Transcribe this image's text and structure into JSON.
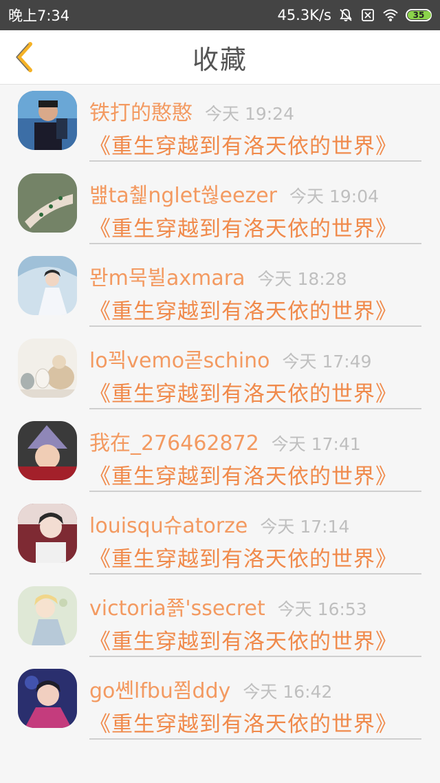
{
  "status_bar": {
    "time": "晚上7:34",
    "network_speed": "45.3K/s",
    "battery_level": "35",
    "icons": [
      "mute-bell-icon",
      "sim-card-icon",
      "wifi-icon",
      "battery-icon"
    ]
  },
  "header": {
    "title": "收藏",
    "back_icon": "chevron-left-icon",
    "accent_color": "#f39a61"
  },
  "favorites": [
    {
      "user": "铁打的憨憨",
      "time": "今天 19:24",
      "novel": "《重生穿越到有洛天依的世界》"
    },
    {
      "user": "뱶ta췙nglet쒆eezer",
      "time": "今天 19:04",
      "novel": "《重生穿越到有洛天依的世界》"
    },
    {
      "user": "뫈m묵뷜axmara",
      "time": "今天 18:28",
      "novel": "《重生穿越到有洛天依的世界》"
    },
    {
      "user": "lo꾁vemo콛schino",
      "time": "今天 17:49",
      "novel": "《重生穿越到有洛天依的世界》"
    },
    {
      "user": "我在_276462872",
      "time": "今天 17:41",
      "novel": "《重生穿越到有洛天依的世界》"
    },
    {
      "user": "louisqu슈atorze",
      "time": "今天 17:14",
      "novel": "《重生穿越到有洛天依的世界》"
    },
    {
      "user": "victoria쬵'ssecret",
      "time": "今天 16:53",
      "novel": "《重生穿越到有洛天依的世界》"
    },
    {
      "user": "go쏀lfbu쬠ddy",
      "time": "今天 16:42",
      "novel": "《重生穿越到有洛天依的世界》"
    }
  ]
}
